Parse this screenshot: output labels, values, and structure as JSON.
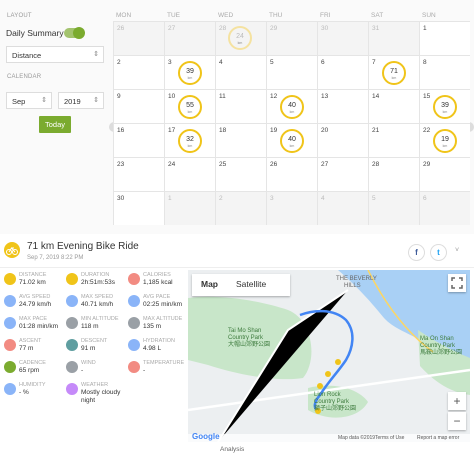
{
  "layout_section": {
    "label": "LAYOUT",
    "summary_label": "Daily Summary",
    "summary_on": true,
    "metric": "Distance"
  },
  "calendar_section": {
    "label": "CALENDAR",
    "month": "Sep",
    "year": "2019",
    "today_label": "Today"
  },
  "weekdays": [
    "MON",
    "TUE",
    "WED",
    "THU",
    "FRI",
    "SAT",
    "SUN"
  ],
  "days": [
    "26",
    "27",
    "28",
    "29",
    "30",
    "31",
    "1",
    "2",
    "3",
    "4",
    "5",
    "6",
    "7",
    "8",
    "9",
    "10",
    "11",
    "12",
    "13",
    "14",
    "15",
    "16",
    "17",
    "18",
    "19",
    "20",
    "21",
    "22",
    "23",
    "24",
    "25",
    "26",
    "27",
    "28",
    "29",
    "30",
    "1",
    "2",
    "3",
    "4",
    "5",
    "6"
  ],
  "rings": {
    "wed_24": "24",
    "tue_3": "39",
    "sat_7": "71",
    "tue_10": "55",
    "thu_12": "40",
    "sun_15": "39",
    "tue_17": "32",
    "thu_19": "40",
    "sun_22": "19",
    "unit": "km"
  },
  "activity": {
    "title": "71 km Evening Bike Ride",
    "datetime": "Sep 7, 2019 8:22 PM",
    "facebook": "f",
    "twitter": "t",
    "collapse": "˅"
  },
  "stats": [
    {
      "label": "DISTANCE",
      "value": "71.02 km",
      "color": "#f0c419"
    },
    {
      "label": "DURATION",
      "value": "2h:51m:53s",
      "color": "#f0c419"
    },
    {
      "label": "CALORIES",
      "value": "1,185 kcal",
      "color": "#f28b82"
    },
    {
      "label": "AVG SPEED",
      "value": "24.79 km/h",
      "color": "#8ab4f8"
    },
    {
      "label": "MAX SPEED",
      "value": "40.71 km/h",
      "color": "#8ab4f8"
    },
    {
      "label": "AVG PACE",
      "value": "02:25 min/km",
      "color": "#8ab4f8"
    },
    {
      "label": "MAX PACE",
      "value": "01:28 min/km",
      "color": "#8ab4f8"
    },
    {
      "label": "MIN ALTITUDE",
      "value": "118 m",
      "color": "#9aa0a6"
    },
    {
      "label": "MAX ALTITUDE",
      "value": "135 m",
      "color": "#9aa0a6"
    },
    {
      "label": "ASCENT",
      "value": "77 m",
      "color": "#f28b82"
    },
    {
      "label": "DESCENT",
      "value": "91 m",
      "color": "#5f9ea0"
    },
    {
      "label": "HYDRATION",
      "value": "4.98 L",
      "color": "#8ab4f8"
    },
    {
      "label": "CADENCE",
      "value": "65 rpm",
      "color": "#7bab2f"
    },
    {
      "label": "WIND",
      "value": "-",
      "color": "#9aa0a6"
    },
    {
      "label": "TEMPERATURE",
      "value": "-",
      "color": "#f28b82"
    },
    {
      "label": "HUMIDITY",
      "value": "- %",
      "color": "#8ab4f8"
    },
    {
      "label": "WEATHER",
      "value": "Mostly cloudy night",
      "color": "#c58af9"
    }
  ],
  "map": {
    "tab_map": "Map",
    "tab_satellite": "Satellite",
    "zoom_in": "+",
    "zoom_out": "−",
    "google": "Google",
    "labels": [
      "Tai Mo Shan",
      "Country Park",
      "大帽山郊野公園",
      "Ma On Shan",
      "Country Park",
      "馬鞍山郊野公園",
      "Lion Rock",
      "Country Park",
      "獅子山郊野公園",
      "THE BEVERLY",
      "HILLS"
    ],
    "attribution": "Map data ©2019",
    "terms": "Terms of Use",
    "report": "Report a map error"
  },
  "footer": {
    "analysis": "Analysis"
  }
}
